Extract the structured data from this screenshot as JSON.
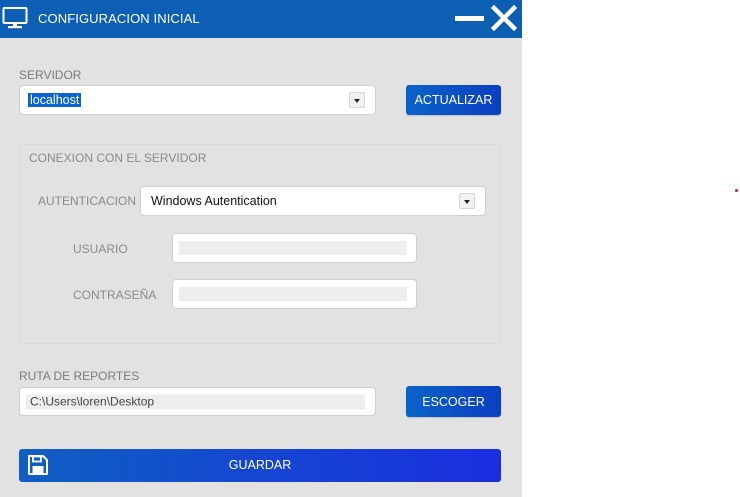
{
  "window": {
    "title": "CONFIGURACION INICIAL",
    "icons": [
      "monitor-icon",
      "minimize-icon",
      "close-icon"
    ]
  },
  "server": {
    "label": "SERVIDOR",
    "value": "localhost",
    "refresh_label": "ACTUALIZAR"
  },
  "connection": {
    "group_label": "CONEXION CON EL SERVIDOR",
    "auth_label": "AUTENTICACION",
    "auth_value": "Windows Autentication",
    "user_label": "USUARIO",
    "user_value": "",
    "password_label": "CONTRASEÑA",
    "password_value": ""
  },
  "reports": {
    "label": "RUTA DE REPORTES",
    "path": "C:\\Users\\loren\\Desktop",
    "choose_label": "ESCOGER"
  },
  "save": {
    "label": "GUARDAR",
    "icon": "floppy-disk-icon"
  },
  "colors": {
    "titlebar": "#0d5fb3",
    "button": "#0a4fc4",
    "background": "#e2e2e2"
  }
}
